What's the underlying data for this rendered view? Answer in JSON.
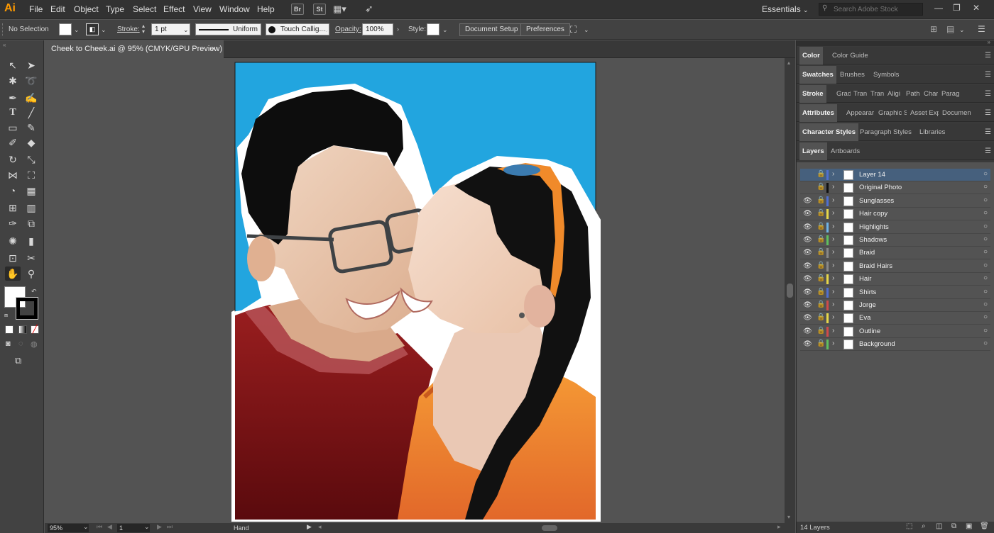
{
  "menubar": {
    "logo": "Ai",
    "items": [
      "File",
      "Edit",
      "Object",
      "Type",
      "Select",
      "Effect",
      "View",
      "Window",
      "Help"
    ],
    "bridge": "Br",
    "stock": "St",
    "workspace": "Essentials",
    "search_placeholder": "Search Adobe Stock"
  },
  "controlbar": {
    "selection": "No Selection",
    "stroke_label": "Stroke:",
    "stroke_weight": "1 pt",
    "profile": "Uniform",
    "brush": "Touch Callig...",
    "opacity_label": "Opacity:",
    "opacity": "100%",
    "style_label": "Style:",
    "document_setup": "Document Setup",
    "preferences": "Preferences"
  },
  "document": {
    "tab_title": "Cheek to Cheek.ai @ 95% (CMYK/GPU Preview)",
    "close": "×"
  },
  "statusbar": {
    "zoom": "95%",
    "artboard": "1",
    "tool": "Hand"
  },
  "panels": {
    "color_tabs": [
      "Color",
      "Color Guide"
    ],
    "swatch_tabs": [
      "Swatches",
      "Brushes",
      "Symbols"
    ],
    "stroke_tabs": [
      "Stroke",
      "Grad",
      "Tran",
      "Tran",
      "Aligi",
      "Path",
      "Char",
      "Parag"
    ],
    "attr_tabs": [
      "Attributes",
      "Appearar",
      "Graphic S",
      "Asset Exp",
      "Documen"
    ],
    "charstyle_tabs": [
      "Character Styles",
      "Paragraph Styles",
      "Libraries"
    ],
    "layer_tabs": [
      "Layers",
      "Artboards"
    ]
  },
  "layers": {
    "count_label": "14 Layers",
    "items": [
      {
        "name": "Layer 14",
        "visible": false,
        "color": "#4f6fd0",
        "selected": true
      },
      {
        "name": "Original Photo",
        "visible": false,
        "color": "#111111",
        "selected": false
      },
      {
        "name": "Sunglasses",
        "visible": true,
        "color": "#4f6fd0",
        "selected": false
      },
      {
        "name": "Hair copy",
        "visible": true,
        "color": "#e7d84a",
        "selected": false
      },
      {
        "name": "Highlights",
        "visible": true,
        "color": "#6fb4e6",
        "selected": false
      },
      {
        "name": "Shadows",
        "visible": true,
        "color": "#5fbf5f",
        "selected": false
      },
      {
        "name": "Braid",
        "visible": true,
        "color": "#888888",
        "selected": false
      },
      {
        "name": "Braid Hairs",
        "visible": true,
        "color": "#888888",
        "selected": false
      },
      {
        "name": "Hair",
        "visible": true,
        "color": "#e7d84a",
        "selected": false
      },
      {
        "name": "Shirts",
        "visible": true,
        "color": "#4f6fd0",
        "selected": false
      },
      {
        "name": "Jorge",
        "visible": true,
        "color": "#d04a4a",
        "selected": false
      },
      {
        "name": "Eva",
        "visible": true,
        "color": "#e7d84a",
        "selected": false
      },
      {
        "name": "Outline",
        "visible": true,
        "color": "#d04a4a",
        "selected": false
      },
      {
        "name": "Background",
        "visible": true,
        "color": "#5fbf5f",
        "selected": false
      }
    ]
  },
  "colors": {
    "accent_logo": "#ff9a00",
    "selected_layer": "#46607d",
    "artboard_sky": "#22a5df"
  }
}
